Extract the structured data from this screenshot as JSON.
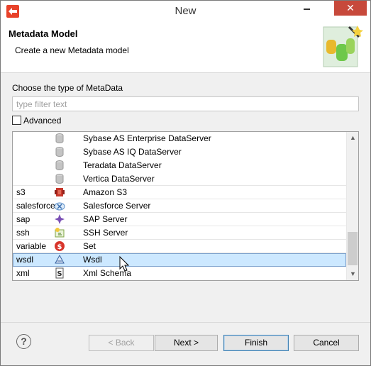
{
  "window": {
    "title": "New",
    "close_label": "✕"
  },
  "header": {
    "title": "Metadata Model",
    "description": "Create a new Metadata model"
  },
  "filter": {
    "label": "Choose the type of MetaData",
    "placeholder": "type filter text",
    "value": ""
  },
  "advanced": {
    "label": "Advanced",
    "checked": false
  },
  "list": {
    "rows": [
      {
        "category": "",
        "name": "Sybase AS Enterprise DataServer",
        "icon": "database-icon"
      },
      {
        "category": "",
        "name": "Sybase AS IQ DataServer",
        "icon": "database-icon"
      },
      {
        "category": "",
        "name": "Teradata DataServer",
        "icon": "database-icon"
      },
      {
        "category": "",
        "name": "Vertica DataServer",
        "icon": "database-icon"
      },
      {
        "category": "s3",
        "name": "Amazon S3",
        "icon": "amazon-s3-icon"
      },
      {
        "category": "salesforce",
        "name": "Salesforce Server",
        "icon": "salesforce-icon"
      },
      {
        "category": "sap",
        "name": "SAP Server",
        "icon": "sap-icon"
      },
      {
        "category": "ssh",
        "name": "SSH Server",
        "icon": "ssh-icon"
      },
      {
        "category": "variable",
        "name": "Set",
        "icon": "set-icon"
      },
      {
        "category": "wsdl",
        "name": "Wsdl",
        "icon": "wsdl-icon",
        "selected": true
      },
      {
        "category": "xml",
        "name": "Xml Schema",
        "icon": "xml-schema-icon"
      }
    ]
  },
  "buttons": {
    "help": "?",
    "back": "< Back",
    "next": "Next >",
    "finish": "Finish",
    "cancel": "Cancel"
  },
  "colors": {
    "selection": "#cce8ff",
    "close_button": "#c7493b",
    "accent": "#3c7fb1"
  }
}
